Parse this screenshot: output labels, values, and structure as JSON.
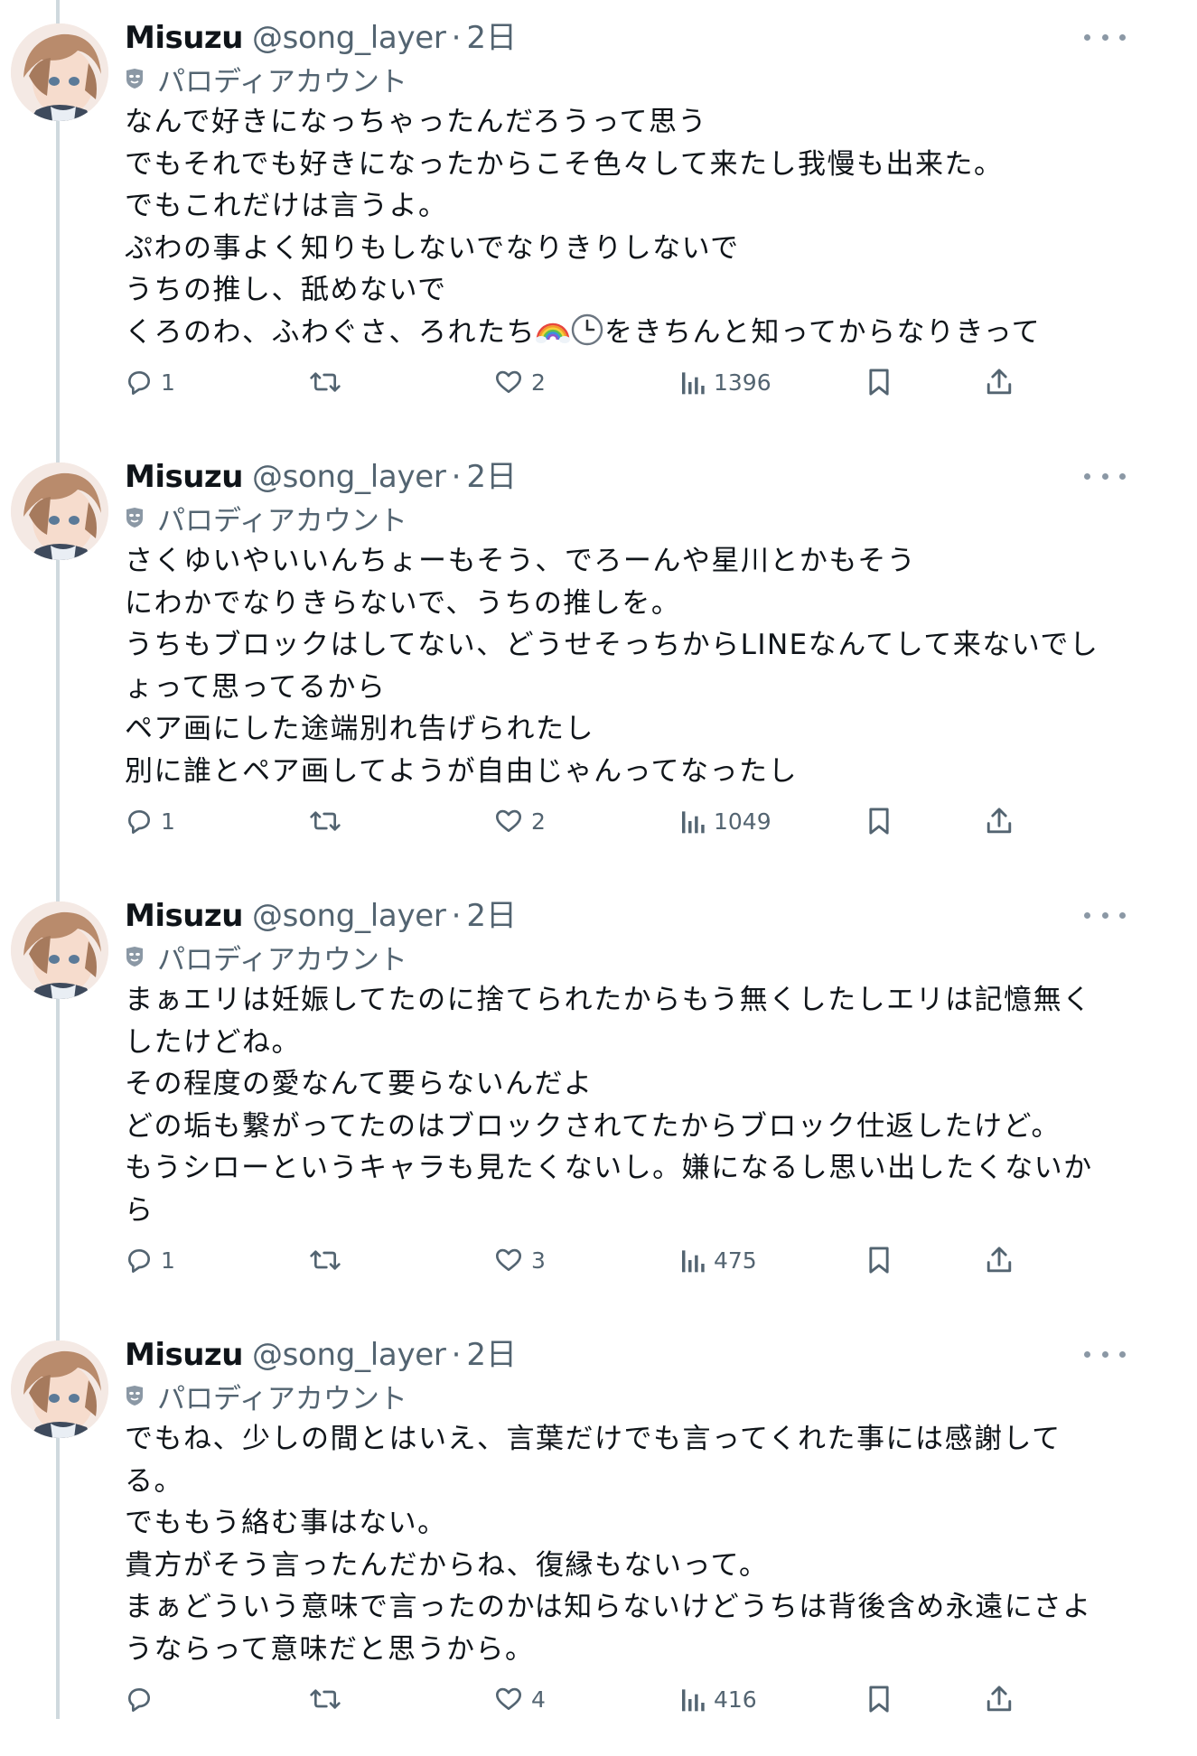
{
  "tweets": [
    {
      "name": "Misuzu",
      "handle": "@song_layer",
      "sep": "·",
      "time": "2日",
      "label": "パロディアカウント",
      "text_before_emoji": "なんで好きになっちゃったんだろうって思う\nでもそれでも好きになったからこそ色々して来たし我慢も出来た。\nでもこれだけは言うよ。\nぷわの事よく知りもしないでなりきりしないで\nうちの推し、舐めないで\nくろのわ、ふわぐさ、ろれたち",
      "emojis": [
        "rainbow",
        "clock"
      ],
      "text_after_emoji": "をきちんと知ってからなりきって",
      "replies": "1",
      "retweets": "",
      "likes": "2",
      "views": "1396"
    },
    {
      "name": "Misuzu",
      "handle": "@song_layer",
      "sep": "·",
      "time": "2日",
      "label": "パロディアカウント",
      "text_before_emoji": "さくゆいやいいんちょーもそう、でろーんや星川とかもそう\nにわかでなりきらないで、うちの推しを。\nうちもブロックはしてない、どうせそっちからLINEなんてして来ないでし\nょって思ってるから\nペア画にした途端別れ告げられたし\n別に誰とペア画してようが自由じゃんってなったし",
      "emojis": [],
      "text_after_emoji": "",
      "replies": "1",
      "retweets": "",
      "likes": "2",
      "views": "1049"
    },
    {
      "name": "Misuzu",
      "handle": "@song_layer",
      "sep": "·",
      "time": "2日",
      "label": "パロディアカウント",
      "text_before_emoji": "まぁエリは妊娠してたのに捨てられたからもう無くしたしエリは記憶無く\nしたけどね。\nその程度の愛なんて要らないんだよ\nどの垢も繋がってたのはブロックされてたからブロック仕返したけど。\nもうシローというキャラも見たくないし。嫌になるし思い出したくないか\nら",
      "emojis": [],
      "text_after_emoji": "",
      "replies": "1",
      "retweets": "",
      "likes": "3",
      "views": "475"
    },
    {
      "name": "Misuzu",
      "handle": "@song_layer",
      "sep": "·",
      "time": "2日",
      "label": "パロディアカウント",
      "text_before_emoji": "でもね、少しの間とはいえ、言葉だけでも言ってくれた事には感謝して\nる。\nでももう絡む事はない。\n貴方がそう言ったんだからね、復縁もないって。\nまぁどういう意味で言ったのかは知らないけどうちは背後含め永遠にさよ\nうならって意味だと思うから。",
      "emojis": [],
      "text_after_emoji": "",
      "replies": "",
      "retweets": "",
      "likes": "4",
      "views": "416"
    }
  ],
  "icons": {
    "more": "more-dots-icon",
    "label": "parody-mask-icon",
    "reply": "reply-icon",
    "retweet": "retweet-icon",
    "like": "heart-icon",
    "views": "views-chart-icon",
    "bookmark": "bookmark-icon",
    "share": "share-icon"
  },
  "colors": {
    "text": "#0f1419",
    "secondary": "#536471",
    "thread_line": "#cfd9de",
    "more_dots": "#8b98a5"
  }
}
